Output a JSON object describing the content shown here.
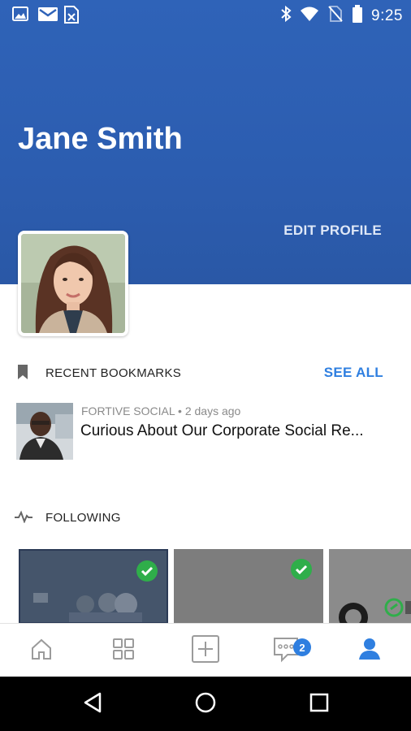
{
  "status_bar": {
    "time": "9:25",
    "left_icons": [
      "image-icon",
      "gmail-icon",
      "sheets-icon"
    ],
    "right_icons": [
      "bluetooth-icon",
      "wifi-icon",
      "no-sim-icon",
      "battery-icon"
    ]
  },
  "profile": {
    "name": "Jane Smith",
    "edit_label": "EDIT PROFILE"
  },
  "bookmarks": {
    "section_label": "RECENT BOOKMARKS",
    "see_all_label": "SEE ALL",
    "items": [
      {
        "source": "FORTIVE SOCIAL",
        "age": "2 days ago",
        "meta": "FORTIVE SOCIAL • 2 days ago",
        "title": "Curious About Our Corporate Social Re..."
      }
    ]
  },
  "following": {
    "section_label": "FOLLOWING"
  },
  "bottom_nav": {
    "items": [
      "home-icon",
      "grid-icon",
      "add-icon",
      "chat-icon",
      "profile-icon"
    ],
    "chat_badge": "2",
    "active": "profile-icon"
  },
  "colors": {
    "header_blue": "#2c5db0",
    "accent_blue": "#2f7fe0",
    "check_green": "#2fae4a"
  }
}
